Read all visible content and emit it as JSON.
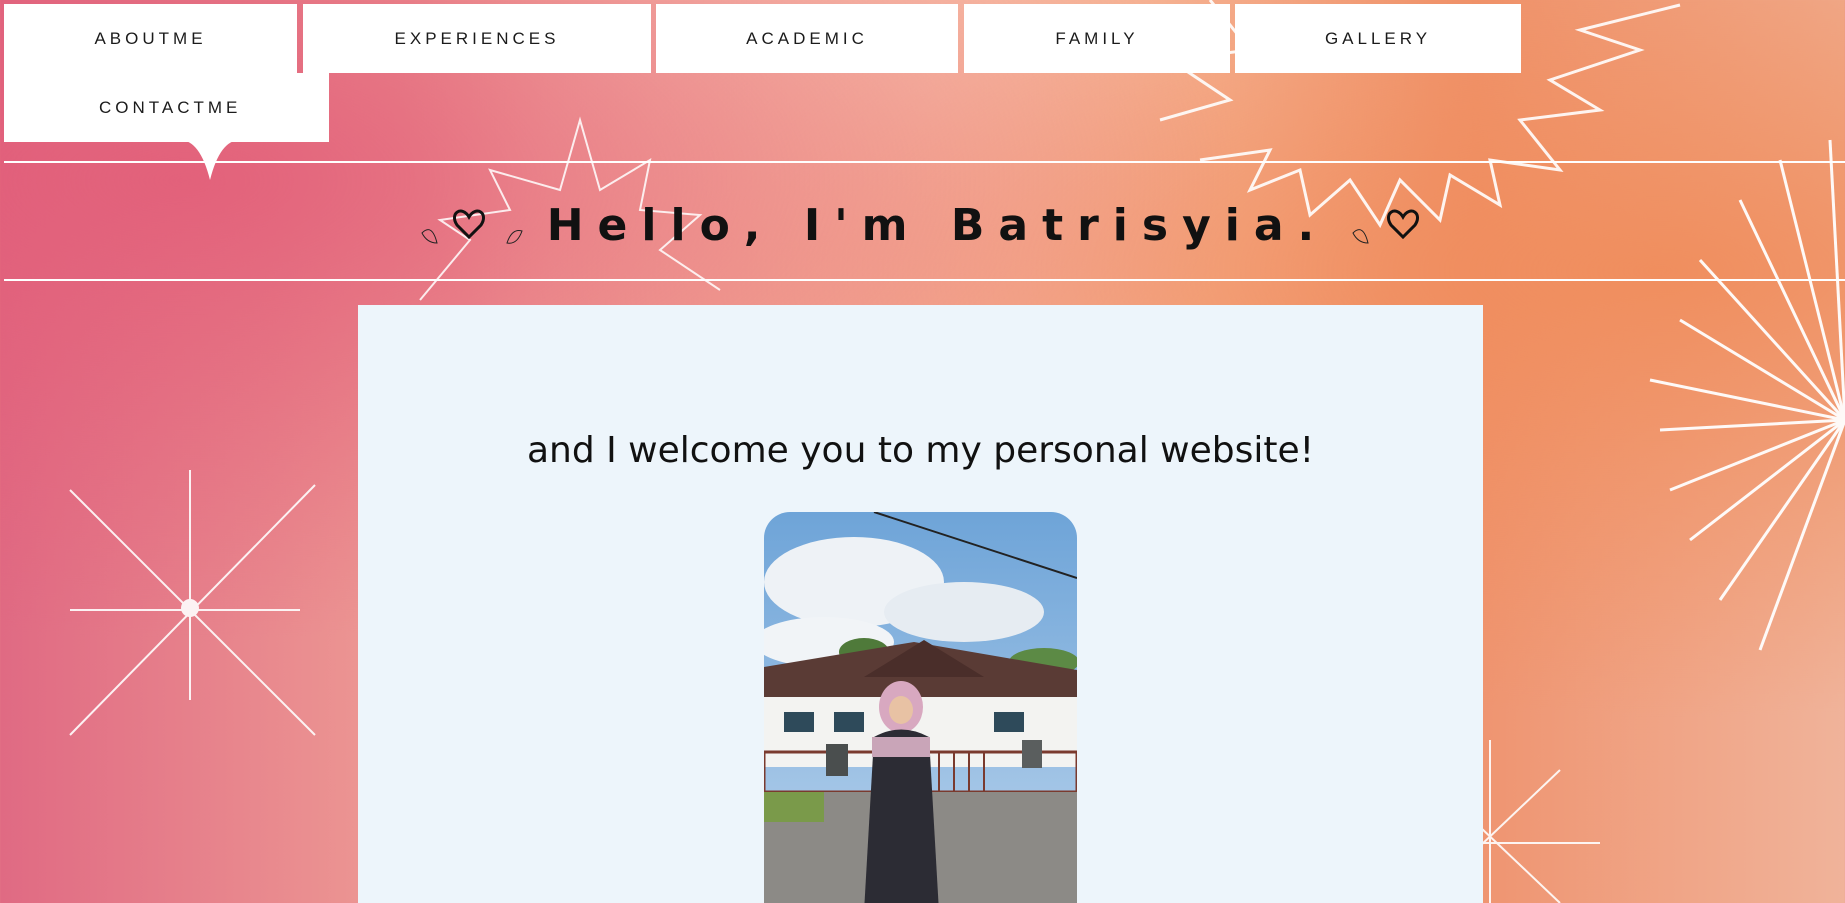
{
  "nav": {
    "items": [
      {
        "label": "ABOUTME"
      },
      {
        "label": "EXPERIENCES"
      },
      {
        "label": "ACADEMIC"
      },
      {
        "label": "FAMILY"
      },
      {
        "label": "GALLERY"
      },
      {
        "label": "CONTACTME"
      }
    ],
    "active": "ABOUTME"
  },
  "hero": {
    "title": "Hello, I'm Batrisyia.",
    "left_icon": "heart-with-leaves-icon",
    "right_icon": "heart-with-leaf-icon"
  },
  "main": {
    "welcome_text": "and I welcome you to my personal website!",
    "photo": {
      "description_icon": "profile-photo"
    }
  },
  "colors": {
    "nav_bg": "#ffffff",
    "card_bg": "#edf5fb",
    "text": "#111111",
    "bg_pink": "#e06a83",
    "bg_orange": "#ef9470"
  }
}
